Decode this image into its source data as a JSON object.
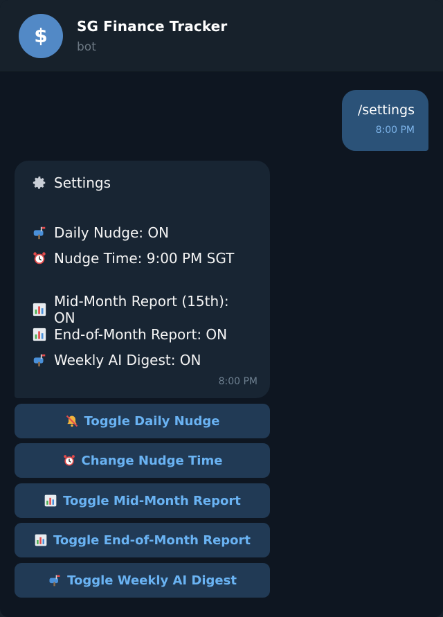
{
  "header": {
    "avatar_symbol": "$",
    "title": "SG Finance Tracker",
    "subtitle": "bot"
  },
  "outgoing": {
    "text": "/settings",
    "time": "8:00 PM"
  },
  "incoming": {
    "title": "Settings",
    "lines": [
      {
        "icon": "mailbox-icon",
        "text": "Daily Nudge: ON"
      },
      {
        "icon": "alarm-clock-icon",
        "text": "Nudge Time: 9:00 PM SGT"
      },
      {
        "icon": "bar-chart-icon",
        "text": "Mid-Month Report (15th): ON"
      },
      {
        "icon": "bar-chart-icon",
        "text": "End-of-Month Report: ON"
      },
      {
        "icon": "mailbox-icon",
        "text": "Weekly AI Digest: ON"
      }
    ],
    "time": "8:00 PM"
  },
  "buttons": [
    {
      "icon": "bell-muted-icon",
      "label": "Toggle Daily Nudge"
    },
    {
      "icon": "alarm-clock-icon",
      "label": "Change Nudge Time"
    },
    {
      "icon": "bar-chart-icon",
      "label": "Toggle Mid-Month Report"
    },
    {
      "icon": "bar-chart-icon",
      "label": "Toggle End-of-Month Report"
    },
    {
      "icon": "mailbox-icon",
      "label": "Toggle Weekly AI Digest"
    }
  ],
  "colors": {
    "background": "#0e1621",
    "header": "#17212b",
    "outgoing_bubble": "#2b5278",
    "incoming_bubble": "#182533",
    "button": "#213a55",
    "button_text": "#6ab3f3",
    "avatar": "#5289c6"
  }
}
